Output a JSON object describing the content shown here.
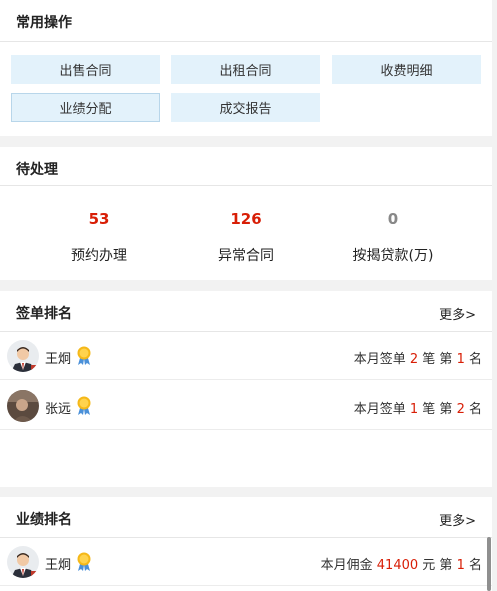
{
  "quick_ops": {
    "title": "常用操作",
    "buttons": [
      "出售合同",
      "出租合同",
      "收费明细",
      "业绩分配",
      "成交报告"
    ]
  },
  "pending": {
    "title": "待处理",
    "stats": [
      {
        "value": "53",
        "label": "预约办理",
        "color": "#d81e06"
      },
      {
        "value": "126",
        "label": "异常合同",
        "color": "#d81e06"
      },
      {
        "value": "0",
        "label": "按揭贷款(万)",
        "color": "#888888"
      }
    ]
  },
  "signing_rank": {
    "title": "签单排名",
    "more": "更多>",
    "rows": [
      {
        "name": "王炯",
        "medal": "gold-medal-icon",
        "prefix": "本月签单",
        "count": "2",
        "unit": "笔 第",
        "rank": "1",
        "suffix": "名"
      },
      {
        "name": "张远",
        "medal": "gold-medal-icon",
        "prefix": "本月签单",
        "count": "1",
        "unit": "笔 第",
        "rank": "2",
        "suffix": "名"
      }
    ]
  },
  "performance_rank": {
    "title": "业绩排名",
    "more": "更多>",
    "rows": [
      {
        "name": "王炯",
        "medal": "gold-medal-icon",
        "prefix": "本月佣金",
        "count": "41400",
        "unit": "元 第",
        "rank": "1",
        "suffix": "名"
      }
    ]
  },
  "colors": {
    "accent_red": "#d81e06",
    "button_bg": "#e3f2fb"
  }
}
